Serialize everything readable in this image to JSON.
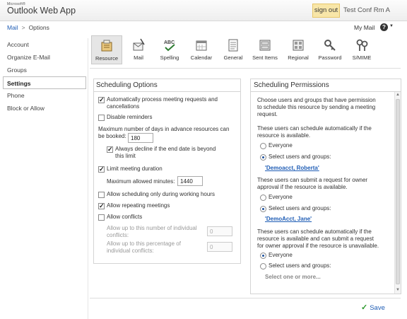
{
  "header": {
    "ms_label": "Microsoft®",
    "app_title": "Outlook Web App",
    "sign_out": "sign out",
    "user": "Test Conf Rm A"
  },
  "breadcrumb": {
    "mail": "Mail",
    "separator": ">",
    "current": "Options"
  },
  "mymail": {
    "label": "My Mail",
    "help": "?",
    "caret": "▼"
  },
  "nav": {
    "items": [
      {
        "label": "Account"
      },
      {
        "label": "Organize E-Mail"
      },
      {
        "label": "Groups"
      },
      {
        "label": "Settings"
      },
      {
        "label": "Phone"
      },
      {
        "label": "Block or Allow"
      }
    ],
    "active": "Settings"
  },
  "toolbar": {
    "items": [
      {
        "label": "Resource",
        "icon": "resource-icon"
      },
      {
        "label": "Mail",
        "icon": "mail-icon"
      },
      {
        "label": "Spelling",
        "icon": "spelling-icon"
      },
      {
        "label": "Calendar",
        "icon": "calendar-icon"
      },
      {
        "label": "General",
        "icon": "general-icon"
      },
      {
        "label": "Sent Items",
        "icon": "sent-items-icon"
      },
      {
        "label": "Regional",
        "icon": "regional-icon"
      },
      {
        "label": "Password",
        "icon": "password-icon"
      },
      {
        "label": "S/MIME",
        "icon": "smime-icon"
      }
    ],
    "active": "Resource"
  },
  "scheduling_options": {
    "title": "Scheduling Options",
    "auto_process_l1": "Automatically process meeting requests and",
    "auto_process_l2": "cancellations",
    "auto_process_checked": true,
    "disable_reminders": "Disable reminders",
    "disable_reminders_checked": false,
    "max_days_l1": "Maximum number of days in advance resources can",
    "max_days_l2": "be booked:",
    "max_days_value": "180",
    "always_decline_l1": "Always decline if the end date is beyond",
    "always_decline_l2": "this limit",
    "always_decline_checked": true,
    "limit_duration": "Limit meeting duration",
    "limit_duration_checked": true,
    "max_minutes_label": "Maximum allowed minutes:",
    "max_minutes_value": "1440",
    "working_hours": "Allow scheduling only during working hours",
    "working_hours_checked": false,
    "repeating": "Allow repeating meetings",
    "repeating_checked": true,
    "conflicts": "Allow conflicts",
    "conflicts_checked": false,
    "conflicts_num_l1": "Allow up to this number of individual",
    "conflicts_num_l2": "conflicts:",
    "conflicts_num_value": "0",
    "conflicts_pct_l1": "Allow up to this percentage of",
    "conflicts_pct_l2": "individual conflicts:",
    "conflicts_pct_value": "0"
  },
  "scheduling_permissions": {
    "title": "Scheduling Permissions",
    "intro_l1": "Choose users and groups that have permission",
    "intro_l2": "to schedule this resource by sending a meeting",
    "intro_l3": "request.",
    "group1_l1": "These users can schedule automatically if the",
    "group1_l2": "resource is available.",
    "group1_everyone": "Everyone",
    "group1_select": "Select users and groups:",
    "group1_selected": "select",
    "group1_users": "'Demoacct, Roberta'",
    "group2_l1": "These users can submit a request for owner",
    "group2_l2": "approval if the resource is available.",
    "group2_everyone": "Everyone",
    "group2_select": "Select users and groups:",
    "group2_selected": "select",
    "group2_users": "'DemoAcct, Jane'",
    "group3_l1": "These users can schedule automatically if the",
    "group3_l2": "resource is available and can submit a request",
    "group3_l3": "for owner approval if the resource is unavailable.",
    "group3_everyone": "Everyone",
    "group3_select": "Select users and groups:",
    "group3_selected": "everyone",
    "group3_placeholder": "Select one or more..."
  },
  "footer": {
    "save": "Save"
  },
  "colors": {
    "accent": "#1f5db5",
    "signout_bg": "#f8e6a8",
    "save_check": "#2e9a2e"
  }
}
